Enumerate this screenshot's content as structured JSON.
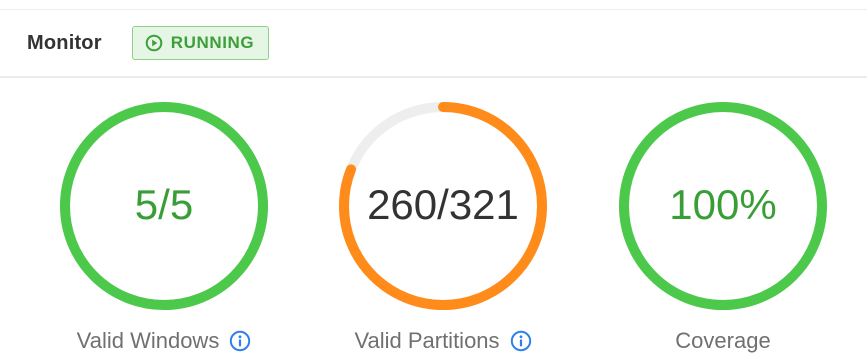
{
  "header": {
    "title": "Monitor",
    "status_label": "RUNNING",
    "status_icon": "play-circle-icon",
    "status_color": "#3e9e3a"
  },
  "metrics": [
    {
      "value": "5/5",
      "label": "Valid Windows",
      "progress": 1.0,
      "ring_color": "#4cc94a",
      "value_color": "#3a9e37",
      "has_info_icon": true
    },
    {
      "value": "260/321",
      "label": "Valid Partitions",
      "progress": 0.81,
      "ring_color": "#ff8c1a",
      "value_color": "#333333",
      "has_info_icon": true
    },
    {
      "value": "100%",
      "label": "Coverage",
      "progress": 1.0,
      "ring_color": "#4cc94a",
      "value_color": "#3a9e37",
      "has_info_icon": false
    }
  ],
  "colors": {
    "track": "#eeeeee",
    "info_icon": "#2f80ed",
    "label": "#707070"
  }
}
